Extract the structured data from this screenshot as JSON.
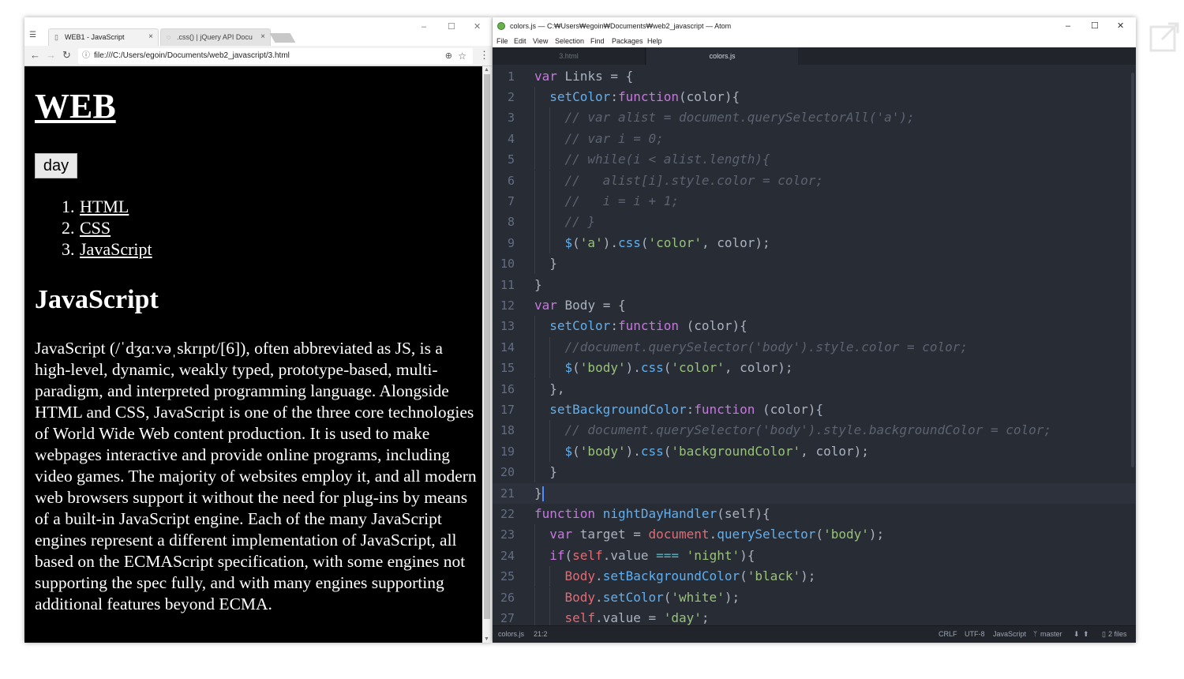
{
  "chrome": {
    "tabs": [
      {
        "label": "WEB1 - JavaScript",
        "icon": "page-icon",
        "close": "×"
      },
      {
        "label": ".css() | jQuery API Docu",
        "icon": "jquery-icon",
        "close": "×"
      }
    ],
    "window_buttons": {
      "minimize": "–",
      "maximize": "☐",
      "close": "✕"
    },
    "url": "file:///C:/Users/egoin/Documents/web2_javascript/3.html",
    "page": {
      "heading": "WEB",
      "toggle_button": "day",
      "nav_links": [
        {
          "num": "1.",
          "label": "HTML"
        },
        {
          "num": "2.",
          "label": "CSS"
        },
        {
          "num": "3.",
          "label": "JavaScript"
        }
      ],
      "section_title": "JavaScript",
      "paragraph": "JavaScript (/ˈdʒɑːvəˌskrɪpt/[6]), often abbreviated as JS, is a high-level, dynamic, weakly typed, prototype-based, multi-paradigm, and interpreted programming language. Alongside HTML and CSS, JavaScript is one of the three core technologies of World Wide Web content production. It is used to make webpages interactive and provide online programs, including video games. The majority of websites employ it, and all modern web browsers support it without the need for plug-ins by means of a built-in JavaScript engine. Each of the many JavaScript engines represent a different implementation of JavaScript, all based on the ECMAScript specification, with some engines not supporting the spec fully, and with many engines supporting additional features beyond ECMA."
    }
  },
  "atom": {
    "title": "colors.js — C:₩Users₩egoin₩Documents₩web2_javascript — Atom",
    "window_buttons": {
      "minimize": "–",
      "maximize": "☐",
      "close": "✕"
    },
    "menu": [
      "File",
      "Edit",
      "View",
      "Selection",
      "Find",
      "Packages",
      "Help"
    ],
    "tabs": [
      {
        "label": "3.html",
        "active": false
      },
      {
        "label": "colors.js",
        "active": true
      }
    ],
    "code_lines": [
      {
        "n": "1",
        "indent": 0,
        "tokens": [
          [
            "k",
            "var"
          ],
          [
            "t",
            " Links = {"
          ]
        ]
      },
      {
        "n": "2",
        "indent": 1,
        "tokens": [
          [
            "f",
            "setColor"
          ],
          [
            "t",
            ":"
          ],
          [
            "k",
            "function"
          ],
          [
            "t",
            "(color){"
          ]
        ]
      },
      {
        "n": "3",
        "indent": 2,
        "tokens": [
          [
            "c",
            "// var alist = document.querySelectorAll('a');"
          ]
        ]
      },
      {
        "n": "4",
        "indent": 2,
        "tokens": [
          [
            "c",
            "// var i = 0;"
          ]
        ]
      },
      {
        "n": "5",
        "indent": 2,
        "tokens": [
          [
            "c",
            "// while(i < alist.length){"
          ]
        ]
      },
      {
        "n": "6",
        "indent": 2,
        "tokens": [
          [
            "c",
            "//   alist[i].style.color = color;"
          ]
        ]
      },
      {
        "n": "7",
        "indent": 2,
        "tokens": [
          [
            "c",
            "//   i = i + 1;"
          ]
        ]
      },
      {
        "n": "8",
        "indent": 2,
        "tokens": [
          [
            "c",
            "// }"
          ]
        ]
      },
      {
        "n": "9",
        "indent": 2,
        "tokens": [
          [
            "f",
            "$"
          ],
          [
            "t",
            "("
          ],
          [
            "s",
            "'a'"
          ],
          [
            "t",
            ")."
          ],
          [
            "f",
            "css"
          ],
          [
            "t",
            "("
          ],
          [
            "s",
            "'color'"
          ],
          [
            "t",
            ", color);"
          ]
        ]
      },
      {
        "n": "10",
        "indent": 1,
        "tokens": [
          [
            "t",
            "}"
          ]
        ]
      },
      {
        "n": "11",
        "indent": 0,
        "tokens": [
          [
            "t",
            "}"
          ]
        ]
      },
      {
        "n": "12",
        "indent": 0,
        "tokens": [
          [
            "k",
            "var"
          ],
          [
            "t",
            " Body = {"
          ]
        ]
      },
      {
        "n": "13",
        "indent": 1,
        "tokens": [
          [
            "f",
            "setColor"
          ],
          [
            "t",
            ":"
          ],
          [
            "k",
            "function"
          ],
          [
            "t",
            " (color){"
          ]
        ]
      },
      {
        "n": "14",
        "indent": 2,
        "tokens": [
          [
            "c",
            "//document.querySelector('body').style.color = color;"
          ]
        ]
      },
      {
        "n": "15",
        "indent": 2,
        "tokens": [
          [
            "f",
            "$"
          ],
          [
            "t",
            "("
          ],
          [
            "s",
            "'body'"
          ],
          [
            "t",
            ")."
          ],
          [
            "f",
            "css"
          ],
          [
            "t",
            "("
          ],
          [
            "s",
            "'color'"
          ],
          [
            "t",
            ", color);"
          ]
        ]
      },
      {
        "n": "16",
        "indent": 1,
        "tokens": [
          [
            "t",
            "},"
          ]
        ]
      },
      {
        "n": "17",
        "indent": 1,
        "tokens": [
          [
            "f",
            "setBackgroundColor"
          ],
          [
            "t",
            ":"
          ],
          [
            "k",
            "function"
          ],
          [
            "t",
            " (color){"
          ]
        ]
      },
      {
        "n": "18",
        "indent": 2,
        "tokens": [
          [
            "c",
            "// document.querySelector('body').style.backgroundColor = color;"
          ]
        ]
      },
      {
        "n": "19",
        "indent": 2,
        "tokens": [
          [
            "f",
            "$"
          ],
          [
            "t",
            "("
          ],
          [
            "s",
            "'body'"
          ],
          [
            "t",
            ")."
          ],
          [
            "f",
            "css"
          ],
          [
            "t",
            "("
          ],
          [
            "s",
            "'backgroundColor'"
          ],
          [
            "t",
            ", color);"
          ]
        ]
      },
      {
        "n": "20",
        "indent": 1,
        "tokens": [
          [
            "t",
            "}"
          ]
        ]
      },
      {
        "n": "21",
        "indent": 0,
        "cursor": true,
        "tokens": [
          [
            "t",
            "}"
          ]
        ]
      },
      {
        "n": "22",
        "indent": 0,
        "tokens": [
          [
            "k",
            "function"
          ],
          [
            "t",
            " "
          ],
          [
            "f",
            "nightDayHandler"
          ],
          [
            "t",
            "(self){"
          ]
        ]
      },
      {
        "n": "23",
        "indent": 1,
        "tokens": [
          [
            "k",
            "var"
          ],
          [
            "t",
            " target = "
          ],
          [
            "v",
            "document"
          ],
          [
            "t",
            "."
          ],
          [
            "f",
            "querySelector"
          ],
          [
            "t",
            "("
          ],
          [
            "s",
            "'body'"
          ],
          [
            "t",
            ");"
          ]
        ]
      },
      {
        "n": "24",
        "indent": 1,
        "tokens": [
          [
            "k",
            "if"
          ],
          [
            "t",
            "("
          ],
          [
            "v",
            "self"
          ],
          [
            "t",
            ".value "
          ],
          [
            "p",
            "==="
          ],
          [
            "t",
            " "
          ],
          [
            "s",
            "'night'"
          ],
          [
            "t",
            "){"
          ]
        ]
      },
      {
        "n": "25",
        "indent": 2,
        "tokens": [
          [
            "v",
            "Body"
          ],
          [
            "t",
            "."
          ],
          [
            "f",
            "setBackgroundColor"
          ],
          [
            "t",
            "("
          ],
          [
            "s",
            "'black'"
          ],
          [
            "t",
            ");"
          ]
        ]
      },
      {
        "n": "26",
        "indent": 2,
        "tokens": [
          [
            "v",
            "Body"
          ],
          [
            "t",
            "."
          ],
          [
            "f",
            "setColor"
          ],
          [
            "t",
            "("
          ],
          [
            "s",
            "'white'"
          ],
          [
            "t",
            ");"
          ]
        ]
      },
      {
        "n": "27",
        "indent": 2,
        "tokens": [
          [
            "v",
            "self"
          ],
          [
            "t",
            ".value = "
          ],
          [
            "s",
            "'day'"
          ],
          [
            "t",
            ";"
          ]
        ]
      }
    ],
    "status": {
      "file": "colors.js",
      "position": "21:2",
      "line_ending": "CRLF",
      "encoding": "UTF-8",
      "grammar": "JavaScript",
      "branch": "master",
      "files": "2 files"
    },
    "colors": {
      "background": "#282c34",
      "keyword": "#c678dd",
      "function": "#61afef",
      "string": "#98c379",
      "comment": "#5c6370",
      "variable": "#e06c75"
    }
  },
  "corner_icon": "external-link-icon"
}
